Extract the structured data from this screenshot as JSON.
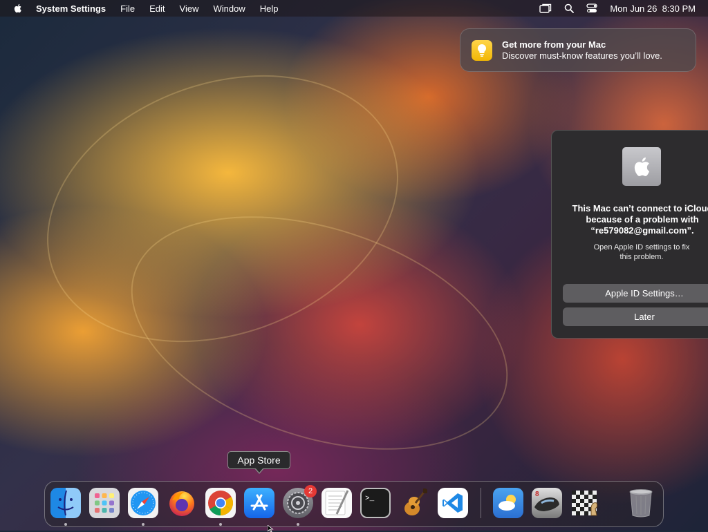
{
  "menubar": {
    "app_name": "System Settings",
    "menus": [
      "File",
      "Edit",
      "View",
      "Window",
      "Help"
    ],
    "datetime": "Mon Jun 26  8:30 PM",
    "status_icons": [
      "screen-mirroring-icon",
      "search-icon",
      "control-center-icon"
    ]
  },
  "notification": {
    "title": "Get more from your Mac",
    "body": "Discover must-know features you’ll love.",
    "icon": "lightbulb-icon"
  },
  "dialog": {
    "icon": "apple-logo-icon",
    "title_lines": [
      "This Mac can’t connect to iCloud",
      "because of a problem with",
      "“re579082@gmail.com”."
    ],
    "message_lines": [
      "Open Apple ID settings to fix",
      "this problem."
    ],
    "primary_button": "Apple ID Settings…",
    "secondary_button": "Later"
  },
  "tooltip": {
    "label": "App Store"
  },
  "dock": {
    "items": [
      {
        "name": "finder",
        "running": true
      },
      {
        "name": "launchpad",
        "running": false
      },
      {
        "name": "safari",
        "running": true
      },
      {
        "name": "firefox",
        "running": false
      },
      {
        "name": "chrome",
        "running": true
      },
      {
        "name": "app-store",
        "running": false
      },
      {
        "name": "system-settings",
        "running": true,
        "badge": "2"
      },
      {
        "name": "textedit",
        "running": false
      },
      {
        "name": "terminal",
        "running": false
      },
      {
        "name": "garageband",
        "running": false
      },
      {
        "name": "vscode",
        "running": false
      },
      {
        "name": "weather",
        "running": false
      },
      {
        "name": "racing-game",
        "running": false
      },
      {
        "name": "chess",
        "running": false
      },
      {
        "name": "trash",
        "running": false
      }
    ]
  }
}
